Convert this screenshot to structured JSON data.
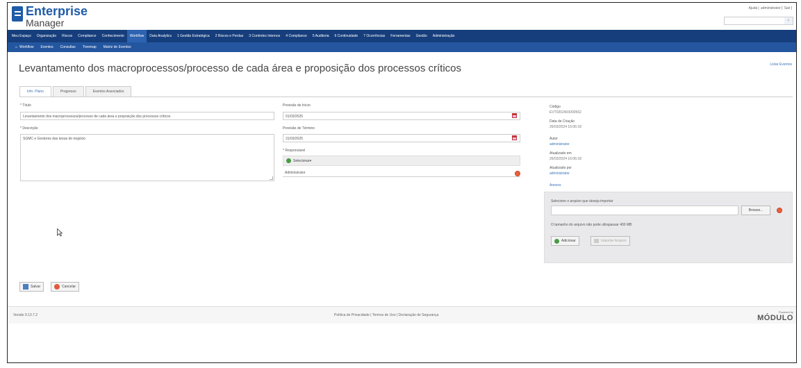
{
  "app": {
    "name": "Enterprise",
    "subname": "Manager"
  },
  "top_links": {
    "help": "Ajuda",
    "user": "administrator",
    "logout": "Sair"
  },
  "menu": [
    "Meu Espaço",
    "Organização",
    "Riscos",
    "Compliance",
    "Conhecimento",
    "Workflow",
    "Data Analytics",
    "1 Gestão Estratégica",
    "2 Riscos e Perdas",
    "3 Controles Internos",
    "4 Compliance",
    "5 Auditoria",
    "6 Continuidade",
    "7 Ocorrências",
    "Ferramentas",
    "Gestão",
    "Administração"
  ],
  "submenu": [
    "Workflow",
    "Eventos",
    "Consultas",
    "Treemap",
    "Matriz de Eventos"
  ],
  "page_title": "Levantamento dos macroprocessos/processo de cada área e proposição dos processos críticos",
  "back_link": "Listar Eventos",
  "tabs": [
    "Info. Plano",
    "Progresso",
    "Eventos Associados"
  ],
  "form": {
    "titulo_label": "* Título",
    "titulo_value": "Levantamento dos macroprocessos/processo de cada área e proposição dos processos críticos",
    "descricao_label": "* Descrição",
    "descricao_value": "SGMC e Gestores das áreas do negócio",
    "inicio_label": "Previsão de Início",
    "inicio_value": "01/03/2025",
    "termino_label": "Previsão de Término",
    "termino_value": "31/03/2025",
    "responsavel_label": "* Responsável",
    "selecionar_label": "Selecionar",
    "responsavel_value": "Administrator"
  },
  "meta": {
    "codigo_label": "Código",
    "codigo_value": "EVT0202403000562",
    "criacao_label": "Data de Criação",
    "criacao_value": "26/03/2024 16:06:18",
    "autor_label": "Autor",
    "autor_value": "administrator",
    "atualizado_em_label": "Atualizado em",
    "atualizado_em_value": "26/03/2024 16:06:18",
    "atualizado_por_label": "Atualizado por",
    "atualizado_por_value": "administrator",
    "anexos_label": "Anexos"
  },
  "anexo": {
    "select_label": "Selecione o arquivo que deseja importar",
    "browse_label": "Browse...",
    "size_note": "O tamanho do arquivo não pode ultrapassar 400 MB",
    "add_label": "Adicionar",
    "import_label": "Importar Arquivo"
  },
  "actions": {
    "save": "Salvar",
    "cancel": "Cancelar"
  },
  "footer": {
    "version": "Versão 9.13.7.2",
    "links": "Política de Privacidade | Termos de Uso | Declaração de Segurança",
    "powered": "Powered by",
    "brand": "MÓDULO"
  },
  "colors": {
    "menu_bg": "#163e7c",
    "submenu_bg": "#2456a0",
    "accent": "#1f5ba8"
  }
}
